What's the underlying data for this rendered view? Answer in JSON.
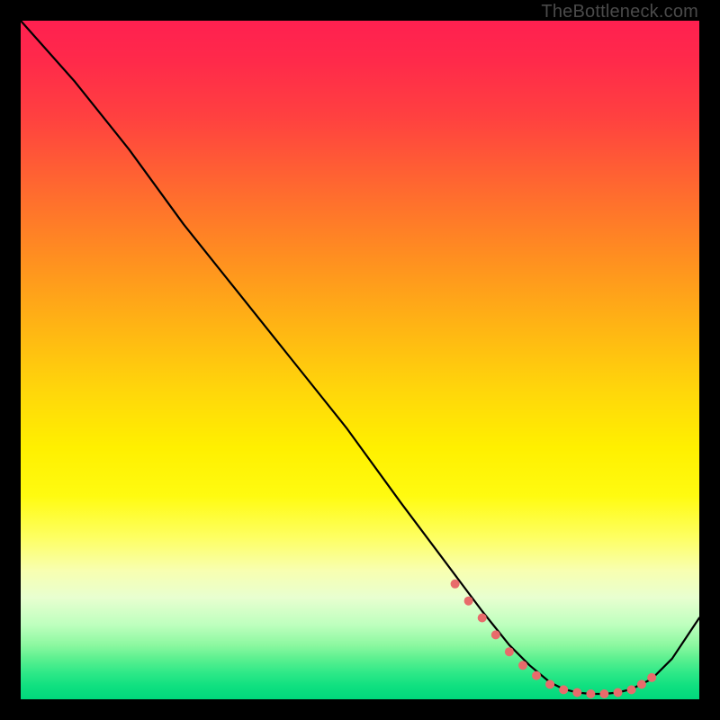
{
  "watermark": "TheBottleneck.com",
  "chart_data": {
    "type": "line",
    "title": "",
    "xlabel": "",
    "ylabel": "",
    "xlim": [
      0,
      100
    ],
    "ylim": [
      0,
      100
    ],
    "series": [
      {
        "name": "bottleneck-curve",
        "x": [
          0,
          8,
          16,
          24,
          32,
          40,
          48,
          56,
          62,
          68,
          72,
          75,
          78,
          80,
          82,
          84,
          86,
          88,
          90,
          93,
          96,
          100
        ],
        "values": [
          100,
          91,
          81,
          70,
          60,
          50,
          40,
          29,
          21,
          13,
          8,
          5,
          2.5,
          1.5,
          1,
          0.8,
          0.8,
          1.0,
          1.5,
          3,
          6,
          12
        ]
      }
    ],
    "markers": {
      "name": "highlight-dots",
      "color": "#e86b6b",
      "x": [
        64,
        66,
        68,
        70,
        72,
        74,
        76,
        78,
        80,
        82,
        84,
        86,
        88,
        90,
        91.5,
        93
      ],
      "values": [
        17,
        14.5,
        12,
        9.5,
        7,
        5,
        3.5,
        2.2,
        1.4,
        1.0,
        0.8,
        0.8,
        1.0,
        1.4,
        2.2,
        3.2
      ]
    }
  }
}
